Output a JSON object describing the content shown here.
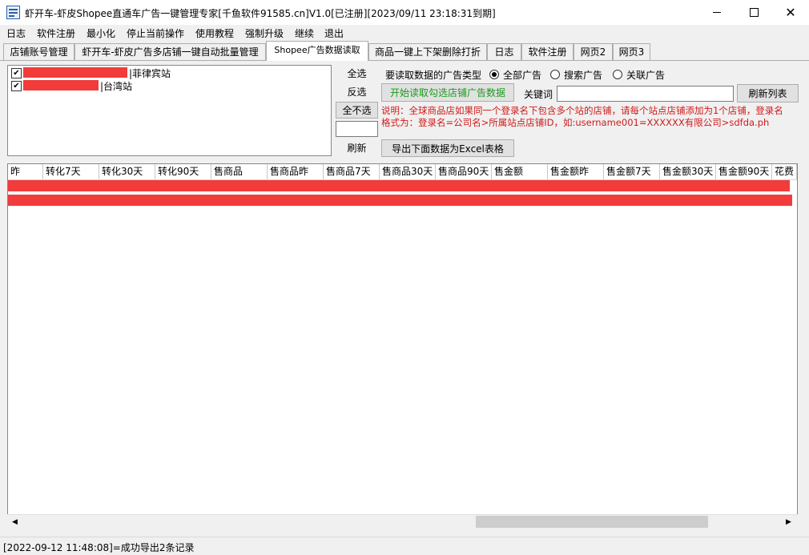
{
  "window": {
    "title": "虾开车-虾皮Shopee直通车广告一键管理专家[千鱼软件91585.cn]V1.0[已注册][2023/09/11 23:18:31到期]"
  },
  "menu": [
    "日志",
    "软件注册",
    "最小化",
    "停止当前操作",
    "使用教程",
    "强制升级",
    "继续",
    "退出"
  ],
  "tabs": [
    {
      "label": "店铺账号管理",
      "active": false
    },
    {
      "label": "虾开车-虾皮广告多店铺一键自动批量管理",
      "active": false
    },
    {
      "label": "Shopee广告数据读取",
      "active": true
    },
    {
      "label": "商品一键上下架删除打折",
      "active": false
    },
    {
      "label": "日志",
      "active": false
    },
    {
      "label": "软件注册",
      "active": false
    },
    {
      "label": "网页2",
      "active": false
    },
    {
      "label": "网页3",
      "active": false
    }
  ],
  "stores": [
    {
      "site": "|菲律宾站",
      "checked": true
    },
    {
      "site": "|台湾站",
      "checked": true
    }
  ],
  "side_buttons": {
    "select_all": "全选",
    "invert": "反选",
    "select_none": "全不选",
    "refresh": "刷新"
  },
  "ad_type": {
    "label": "要读取数据的广告类型",
    "options": [
      {
        "label": "全部广告",
        "selected": true
      },
      {
        "label": "搜索广告",
        "selected": false
      },
      {
        "label": "关联广告",
        "selected": false
      }
    ]
  },
  "actions": {
    "start_read": "开始读取勾选店铺广告数据",
    "keyword_label": "关键词",
    "keyword_value": "",
    "refresh_list": "刷新列表",
    "export_excel": "导出下面数据为Excel表格"
  },
  "note": "说明：全球商品店如果同一个登录名下包含多个站的店铺，请每个站点店铺添加为1个店铺，登录名格式为：登录名=公司名>所属站点店铺ID，如:username001=XXXXXX有限公司>sdfda.ph",
  "grid": {
    "columns": [
      "昨",
      "转化7天",
      "转化30天",
      "转化90天",
      "售商品",
      "售商品昨",
      "售商品7天",
      "售商品30天",
      "售商品90天",
      "售金额",
      "售金额昨",
      "售金额7天",
      "售金额30天",
      "售金额90天",
      "花费"
    ],
    "row_count": 2
  },
  "status": "[2022-09-12 11:48:08]=成功导出2条记录",
  "colors": {
    "redaction": "#f23b3b",
    "note_text": "#d11a1a",
    "start_button_text": "#1a9a1a"
  }
}
